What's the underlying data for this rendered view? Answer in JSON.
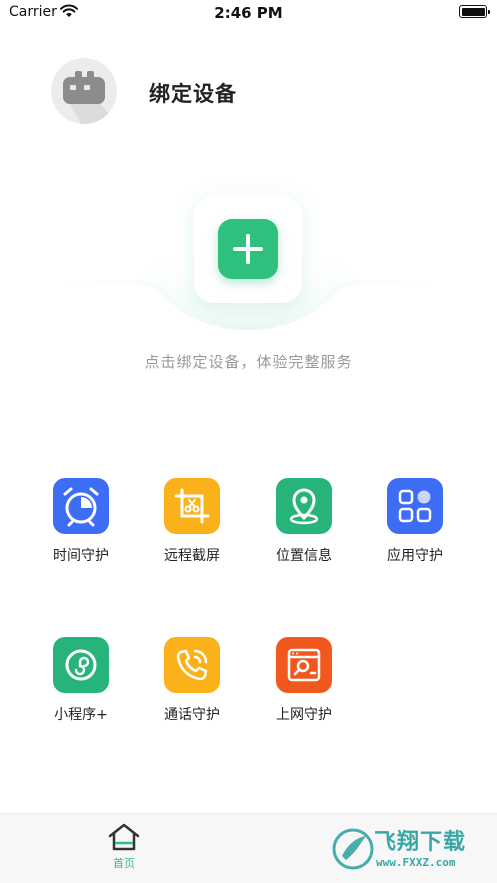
{
  "status_bar": {
    "carrier": "Carrier",
    "time": "2:46 PM"
  },
  "header": {
    "title": "绑定设备"
  },
  "hero": {
    "hint": "点击绑定设备，体验完整服务"
  },
  "features": [
    {
      "label": "时间守护",
      "icon": "alarm-clock-icon",
      "color": "#3d6cf5"
    },
    {
      "label": "远程截屏",
      "icon": "screenshot-crop-icon",
      "color": "#fbb21a"
    },
    {
      "label": "位置信息",
      "icon": "location-pin-icon",
      "color": "#27b47a"
    },
    {
      "label": "应用守护",
      "icon": "app-grid-icon",
      "color": "#3d6cf5"
    },
    {
      "label": "小程序+",
      "icon": "mini-program-icon",
      "color": "#27b47a"
    },
    {
      "label": "通话守护",
      "icon": "phone-call-icon",
      "color": "#fbb21a"
    },
    {
      "label": "上网守护",
      "icon": "browser-search-icon",
      "color": "#f2571d"
    }
  ],
  "tab_bar": {
    "home_label": "首页",
    "accent": "#2fc07d"
  },
  "watermark": {
    "text": "飞翔下载",
    "url": "www.FXXZ.com"
  }
}
